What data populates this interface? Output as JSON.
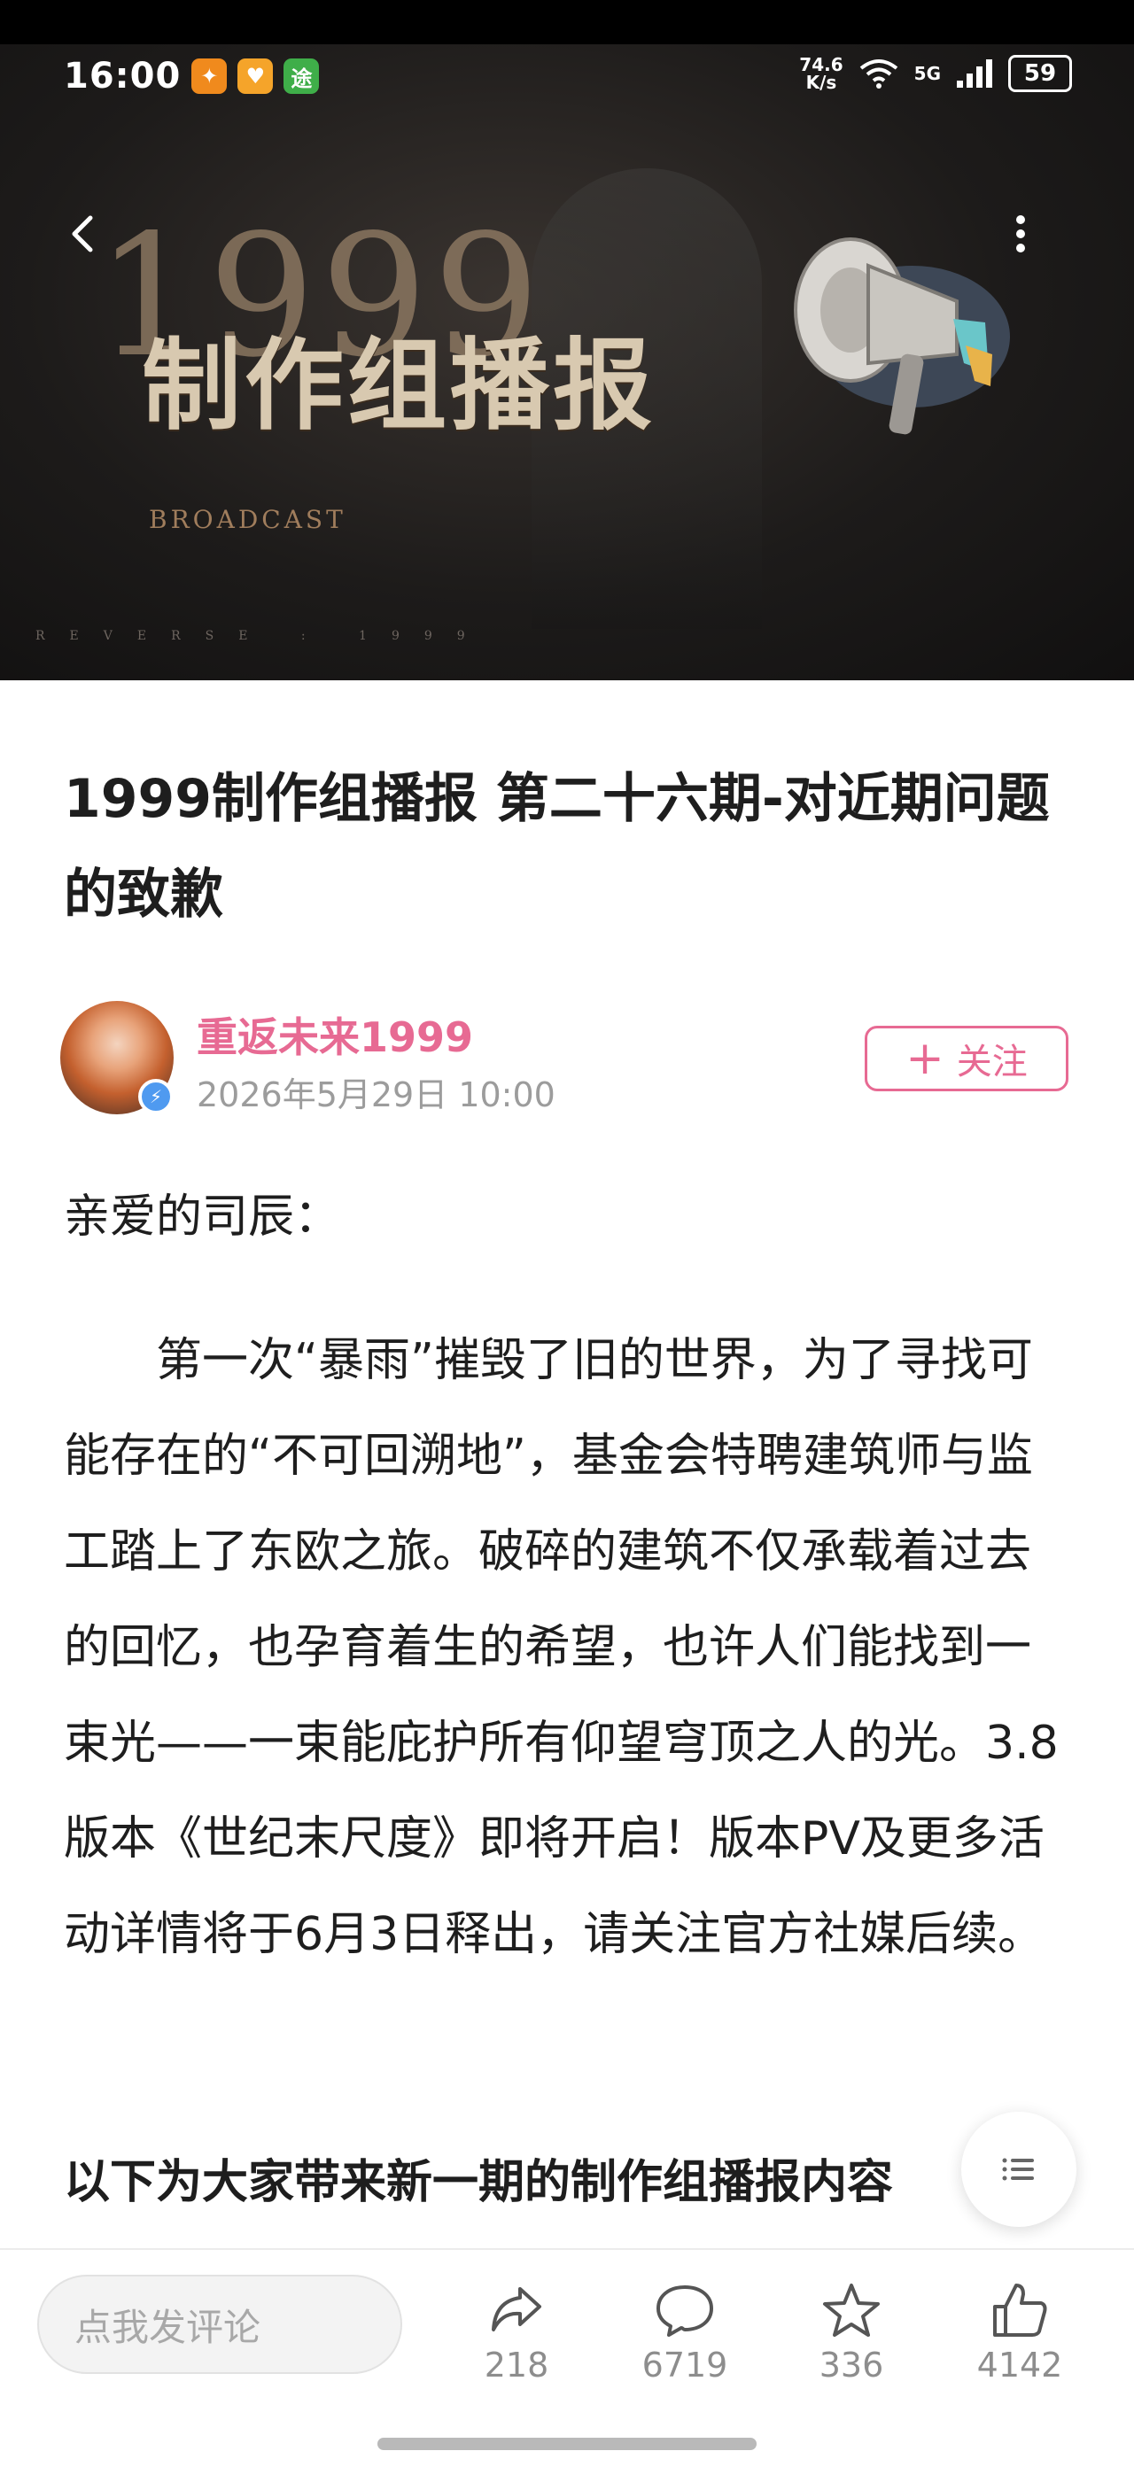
{
  "status_bar": {
    "time": "16:00",
    "net_speed_value": "74.6",
    "net_speed_unit": "K/s",
    "signal_label": "5G",
    "battery": "59",
    "app_icons": [
      "app-notification-icon",
      "heart-app-icon",
      "tuniu-app-icon"
    ]
  },
  "hero": {
    "number": "1999",
    "title": "制作组播报",
    "subtitle": "BROADCAST",
    "footer": "REVERSE : 1999"
  },
  "article": {
    "title": "1999制作组播报 第二十六期-对近期问题的致歉"
  },
  "author": {
    "name": "重返未来1999",
    "date": "2026年5月29日 10:00",
    "follow_label": "关注"
  },
  "content": {
    "greeting": "亲爱的司辰：",
    "paragraph": "第一次“暴雨”摧毁了旧的世界，为了寻找可能存在的“不可回溯地”，基金会特聘建筑师与监工踏上了东欧之旅。破碎的建筑不仅承载着过去的回忆，也孕育着生的希望，也许人们能找到一束光——一束能庇护所有仰望穹顶之人的光。3.8版本《世纪末尺度》即将开启！版本PV及更多活动详情将于6月3日释出，请关注官方社媒后续。",
    "section_heading": "以下为大家带来新一期的制作组播报内容"
  },
  "bottom_bar": {
    "comment_placeholder": "点我发评论",
    "share_count": "218",
    "comment_count": "6719",
    "favorite_count": "336",
    "like_count": "4142"
  },
  "colors": {
    "accent": "#e76a93",
    "hero_bg": "#1d1b1a",
    "badge": "#4f9af0"
  }
}
